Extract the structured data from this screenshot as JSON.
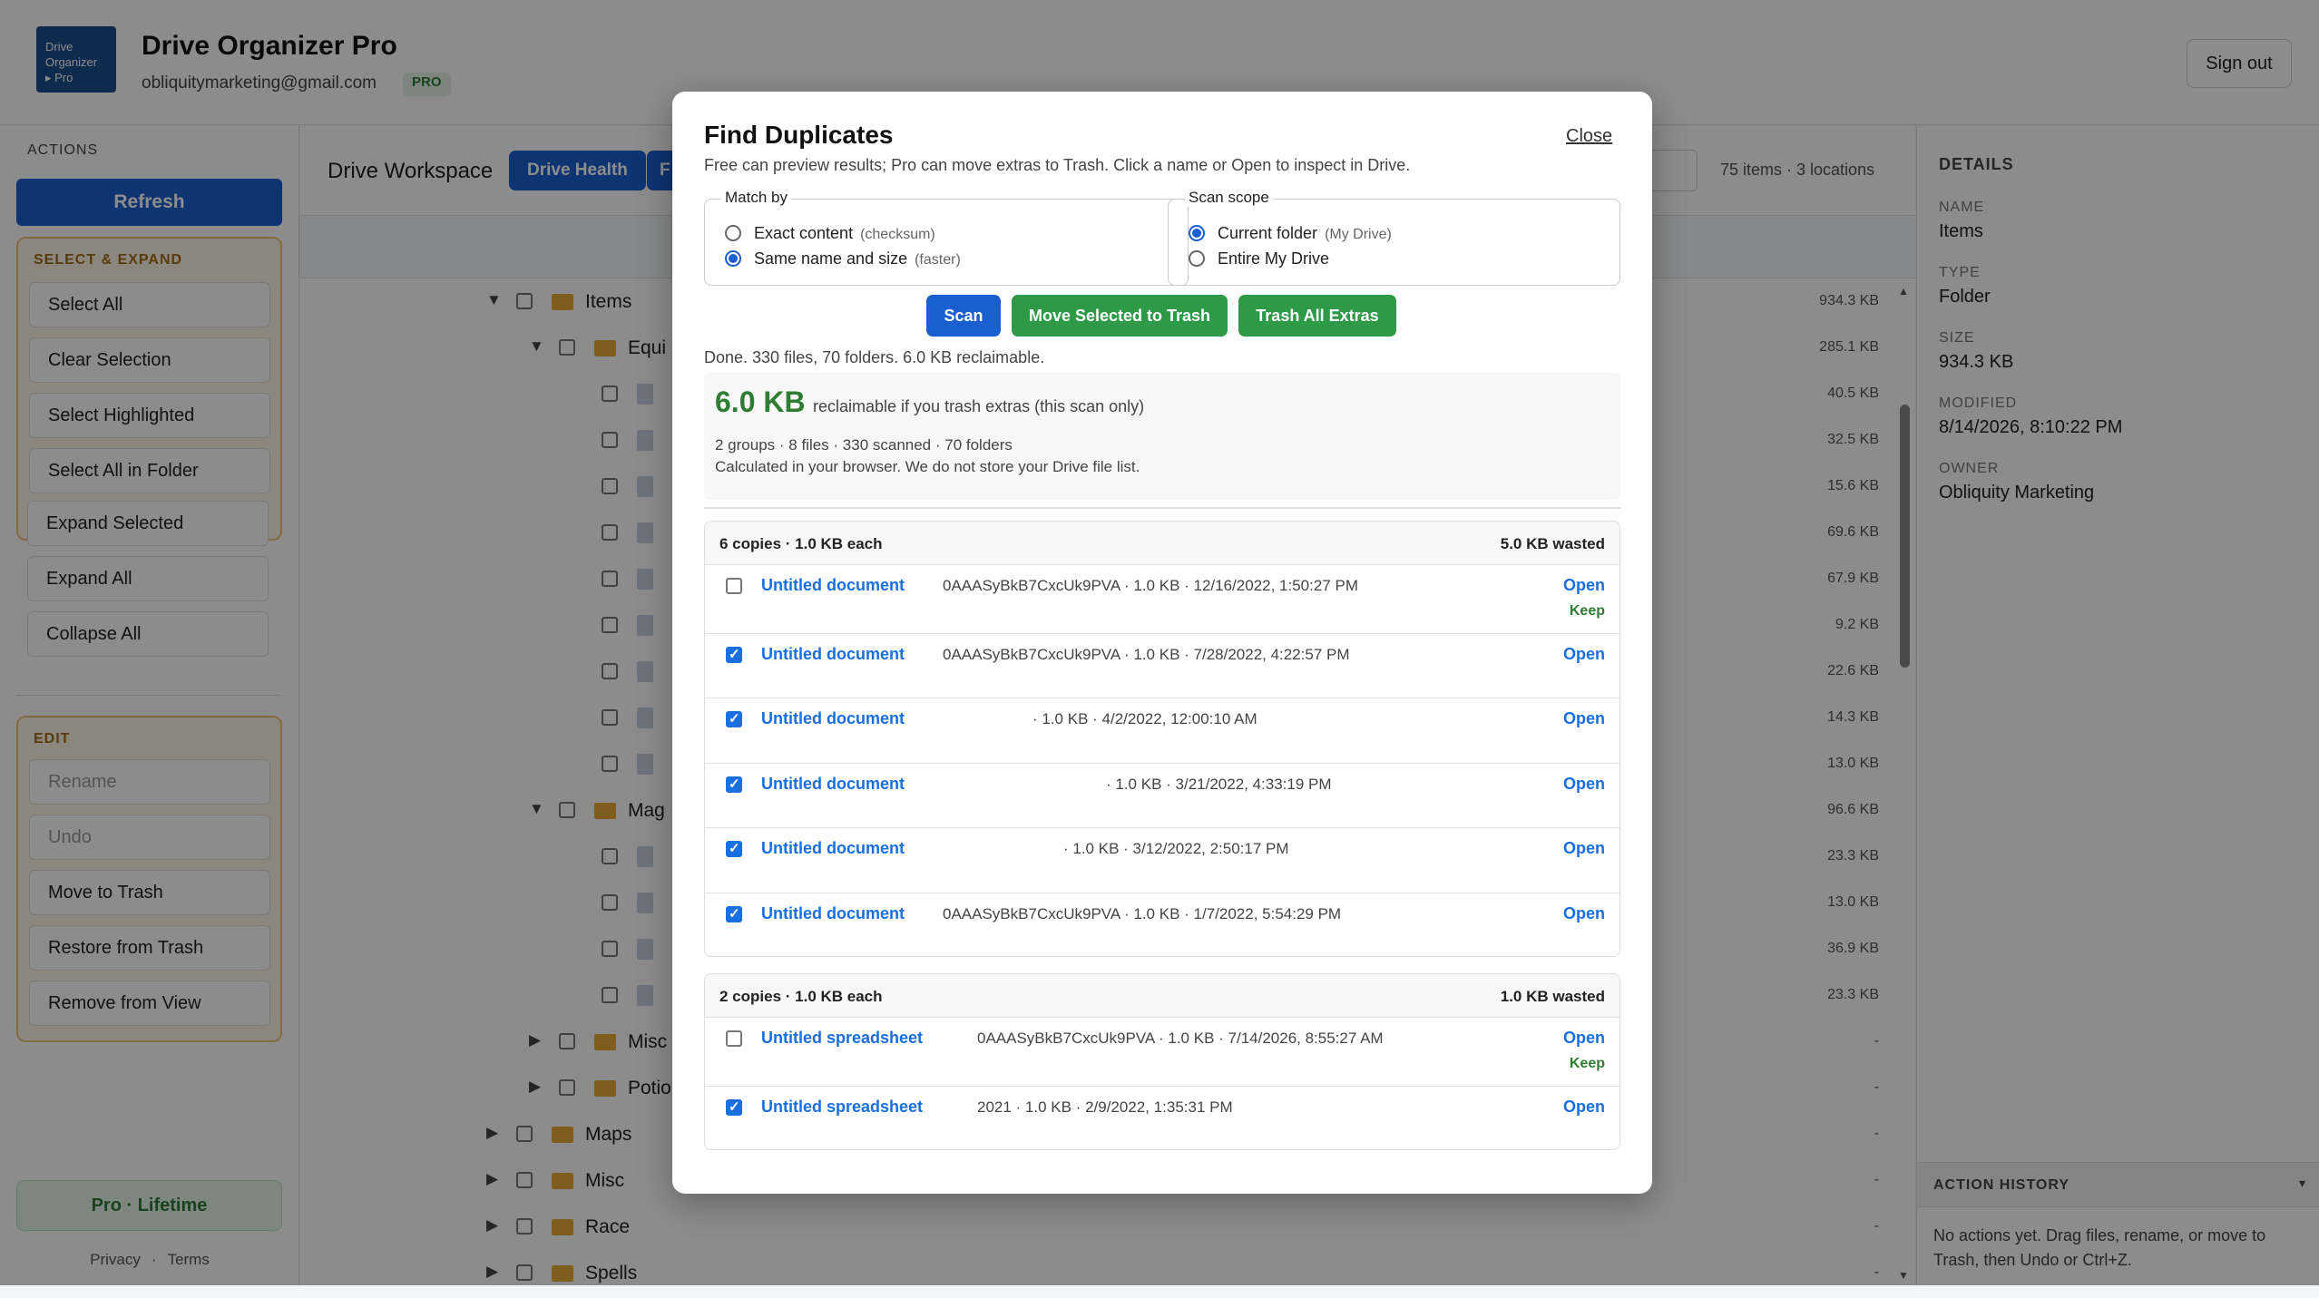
{
  "header": {
    "logo_lines": [
      "Drive",
      "Organizer",
      "▸ Pro"
    ],
    "title": "Drive Organizer Pro",
    "email": "obliquitymarketing@gmail.com",
    "badge": "PRO",
    "signout": "Sign out"
  },
  "sidebar": {
    "actions_label": "ACTIONS",
    "refresh": "Refresh",
    "select_expand": {
      "title": "SELECT & EXPAND",
      "items": [
        "Select All",
        "Clear Selection",
        "Select Highlighted",
        "Select All in Folder",
        "Expand Selected",
        "Expand All",
        "Collapse All"
      ]
    },
    "edit": {
      "title": "EDIT",
      "items": [
        "Rename",
        "Undo",
        "Move to Trash",
        "Restore from Trash",
        "Remove from View"
      ]
    },
    "pro_lifetime": "Pro · Lifetime",
    "privacy": "Privacy",
    "dot": "·",
    "terms": "Terms"
  },
  "workspace": {
    "title": "Drive Workspace",
    "drive_health": "Drive Health",
    "next_button": "F",
    "items_count": "75 items · 3 locations",
    "tree": [
      {
        "name": "Items",
        "size": "934.3 KB"
      },
      {
        "name": "Equi",
        "size": "285.1 KB"
      },
      {
        "name": "",
        "size": "40.5 KB"
      },
      {
        "name": "",
        "size": "32.5 KB"
      },
      {
        "name": "",
        "size": "15.6 KB"
      },
      {
        "name": "",
        "size": "69.6 KB"
      },
      {
        "name": "",
        "size": "67.9 KB"
      },
      {
        "name": "",
        "size": "9.2 KB"
      },
      {
        "name": "",
        "size": "22.6 KB"
      },
      {
        "name": "",
        "size": "14.3 KB"
      },
      {
        "name": "",
        "size": "13.0 KB"
      },
      {
        "name": "Mag",
        "size": "96.6 KB"
      },
      {
        "name": "",
        "size": "23.3 KB"
      },
      {
        "name": "",
        "size": "13.0 KB"
      },
      {
        "name": "",
        "size": "36.9 KB"
      },
      {
        "name": "",
        "size": "23.3 KB"
      },
      {
        "name": "Misc",
        "size": "-"
      },
      {
        "name": "Potio",
        "size": "-"
      },
      {
        "name": "Maps",
        "size": "-"
      },
      {
        "name": "Misc",
        "size": "-"
      },
      {
        "name": "Race",
        "size": "-"
      },
      {
        "name": "Spells",
        "size": "-"
      }
    ]
  },
  "details": {
    "title": "DETAILS",
    "name_label": "NAME",
    "name": "Items",
    "type_label": "TYPE",
    "type": "Folder",
    "size_label": "SIZE",
    "size": "934.3 KB",
    "modified_label": "MODIFIED",
    "modified": "8/14/2026, 8:10:22 PM",
    "owner_label": "OWNER",
    "owner": "Obliquity Marketing",
    "history_title": "ACTION HISTORY",
    "history_caret": "▾",
    "history_text": "No actions yet. Drag files, rename, or move to Trash, then Undo or Ctrl+Z."
  },
  "modal": {
    "title": "Find Duplicates",
    "close": "Close",
    "subtitle": "Free can preview results; Pro can move extras to Trash. Click a name or Open to inspect in Drive.",
    "match_by": {
      "legend": "Match by",
      "opt1": "Exact content",
      "opt1_hint": "(checksum)",
      "opt2": "Same name and size",
      "opt2_hint": "(faster)"
    },
    "scope": {
      "legend": "Scan scope",
      "opt1": "Current folder",
      "opt1_hint": "(My Drive)",
      "opt2": "Entire My Drive"
    },
    "scan": "Scan",
    "move_selected": "Move Selected to Trash",
    "trash_all": "Trash All Extras",
    "status": "Done. 330 files, 70 folders. 6.0 KB reclaimable.",
    "summary": {
      "amount": "6.0 KB",
      "amount_sub": "reclaimable if you trash extras (this scan only)",
      "line1": "2 groups · 8 files · 330 scanned · 70 folders",
      "line2": "Calculated in your browser. We do not store your Drive file list."
    },
    "groups": [
      {
        "header": "6 copies · 1.0 KB each",
        "wasted": "5.0 KB wasted",
        "rows": [
          {
            "name": "Untitled document",
            "meta": "0AAASyBkB7CxcUk9PVA · 1.0 KB · 12/16/2022, 1:50:27 PM",
            "open": "Open",
            "keep": "Keep"
          },
          {
            "name": "Untitled document",
            "meta": "0AAASyBkB7CxcUk9PVA · 1.0 KB · 7/28/2022, 4:22:57 PM",
            "open": "Open"
          },
          {
            "name": "Untitled document",
            "meta": "· 1.0 KB · 4/2/2022, 12:00:10 AM",
            "open": "Open"
          },
          {
            "name": "Untitled document",
            "meta": "· 1.0 KB · 3/21/2022, 4:33:19 PM",
            "open": "Open"
          },
          {
            "name": "Untitled document",
            "meta": "· 1.0 KB · 3/12/2022, 2:50:17 PM",
            "open": "Open"
          },
          {
            "name": "Untitled document",
            "meta": "0AAASyBkB7CxcUk9PVA · 1.0 KB · 1/7/2022, 5:54:29 PM",
            "open": "Open"
          }
        ]
      },
      {
        "header": "2 copies · 1.0 KB each",
        "wasted": "1.0 KB wasted",
        "rows": [
          {
            "name": "Untitled spreadsheet",
            "meta": "0AAASyBkB7CxcUk9PVA · 1.0 KB · 7/14/2026, 8:55:27 AM",
            "open": "Open",
            "keep": "Keep"
          },
          {
            "name": "Untitled spreadsheet",
            "meta": "2021 · 1.0 KB · 2/9/2022, 1:35:31 PM",
            "open": "Open"
          }
        ]
      }
    ]
  },
  "colors": {
    "primary": "#1a5fd0",
    "success": "#2e9a47",
    "link": "#1a6fe0",
    "group_border": "#f0c27a",
    "group_bg": "#fff6e6"
  }
}
